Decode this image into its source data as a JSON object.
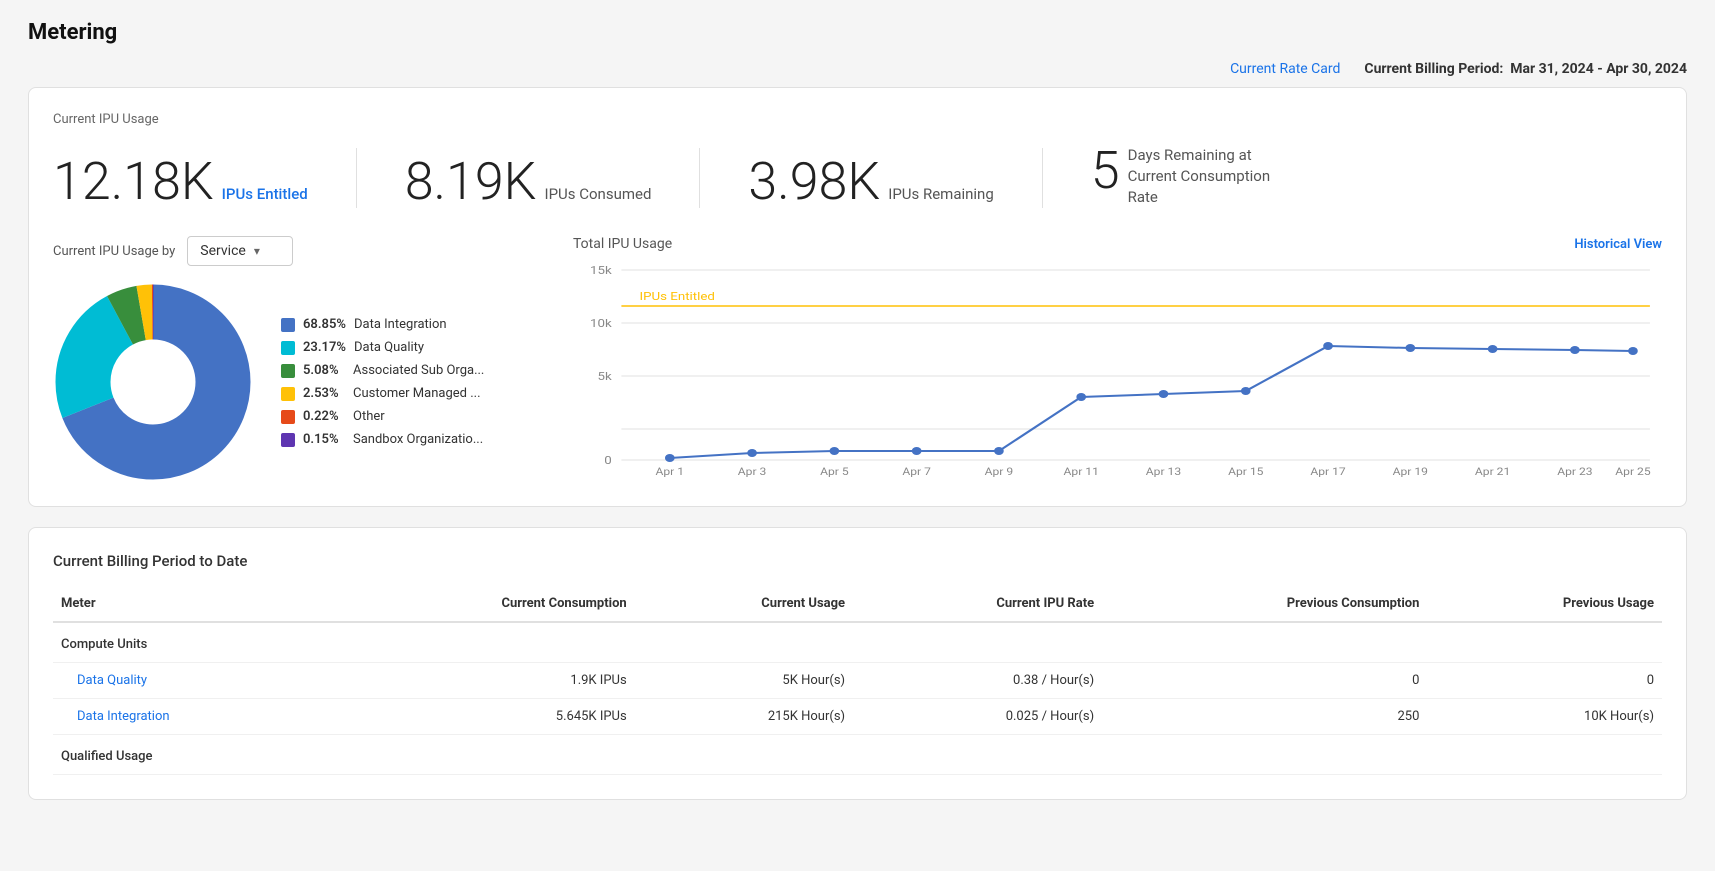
{
  "page": {
    "title": "Metering"
  },
  "topbar": {
    "rate_card_label": "Current Rate Card",
    "billing_period_prefix": "Current Billing Period:",
    "billing_period_value": "Mar 31, 2024 - Apr 30, 2024"
  },
  "ipu_usage": {
    "section_label": "Current IPU Usage",
    "stats": [
      {
        "number": "12.18K",
        "label": "IPUs Entitled",
        "type": "blue"
      },
      {
        "number": "8.19K",
        "label": "IPUs Consumed",
        "type": "gray"
      },
      {
        "number": "3.98K",
        "label": "IPUs Remaining",
        "type": "gray"
      },
      {
        "number": "5",
        "label": "Days Remaining at Current Consumption Rate",
        "type": "gray"
      }
    ]
  },
  "usage_by": {
    "label": "Current IPU Usage by",
    "dropdown_value": "Service",
    "historical_view_label": "Historical View",
    "total_ipu_title": "Total IPU Usage",
    "legend": [
      {
        "pct": "68.85%",
        "name": "Data Integration",
        "color": "#4472C4"
      },
      {
        "pct": "23.17%",
        "name": "Data Quality",
        "color": "#00BCD4"
      },
      {
        "pct": "5.08%",
        "name": "Associated Sub Orga...",
        "color": "#388E3C"
      },
      {
        "pct": "2.53%",
        "name": "Customer Managed ...",
        "color": "#FFC107"
      },
      {
        "pct": "0.22%",
        "name": "Other",
        "color": "#E64A19"
      },
      {
        "pct": "0.15%",
        "name": "Sandbox Organizatio...",
        "color": "#5E35B1"
      }
    ],
    "chart": {
      "y_labels": [
        "15k",
        "10k",
        "5k",
        "0"
      ],
      "x_labels": [
        "Apr 1",
        "Apr 3",
        "Apr 5",
        "Apr 7",
        "Apr 9",
        "Apr 11",
        "Apr 13",
        "Apr 15",
        "Apr 17",
        "Apr 19",
        "Apr 21",
        "Apr 23",
        "Apr 25"
      ],
      "entitled_label": "IPUs Entitled",
      "entitled_color": "#FFC107",
      "line_color": "#4472C4"
    }
  },
  "billing_table": {
    "section_label": "Current Billing Period to Date",
    "columns": [
      "Meter",
      "Current Consumption",
      "Current Usage",
      "Current IPU Rate",
      "Previous Consumption",
      "Previous Usage"
    ],
    "sections": [
      {
        "category": "Compute Units",
        "rows": [
          {
            "meter": "Data Quality",
            "meter_link": true,
            "current_consumption": "1.9K IPUs",
            "current_usage": "5K Hour(s)",
            "current_ipu_rate": "0.38 / Hour(s)",
            "previous_consumption": "0",
            "previous_usage": "0"
          },
          {
            "meter": "Data Integration",
            "meter_link": true,
            "current_consumption": "5.645K IPUs",
            "current_usage": "215K Hour(s)",
            "current_ipu_rate": "0.025 / Hour(s)",
            "previous_consumption": "250",
            "previous_usage": "10K Hour(s)"
          }
        ]
      },
      {
        "category": "Qualified Usage",
        "rows": []
      }
    ]
  }
}
